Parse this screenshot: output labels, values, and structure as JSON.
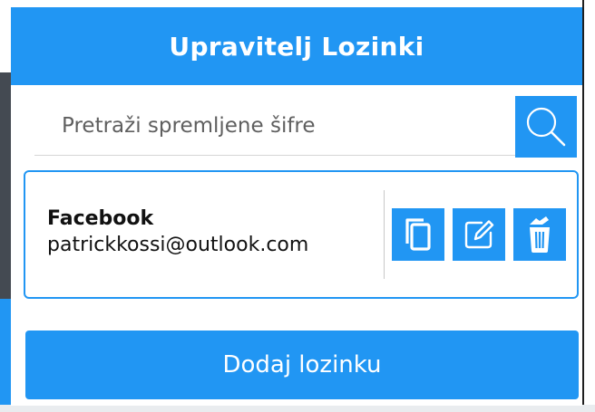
{
  "header": {
    "title": "Upravitelj Lozinki"
  },
  "search": {
    "placeholder": "Pretraži spremljene šifre",
    "value": "",
    "button_icon": "search-icon"
  },
  "entries": [
    {
      "site": "Facebook",
      "username": "patrickkossi@outlook.com",
      "actions": [
        "copy-icon",
        "edit-icon",
        "delete-icon"
      ]
    }
  ],
  "footer": {
    "add_label": "Dodaj lozinku"
  },
  "colors": {
    "accent": "#2196f3",
    "text": "#111111",
    "on_accent": "#ffffff"
  }
}
